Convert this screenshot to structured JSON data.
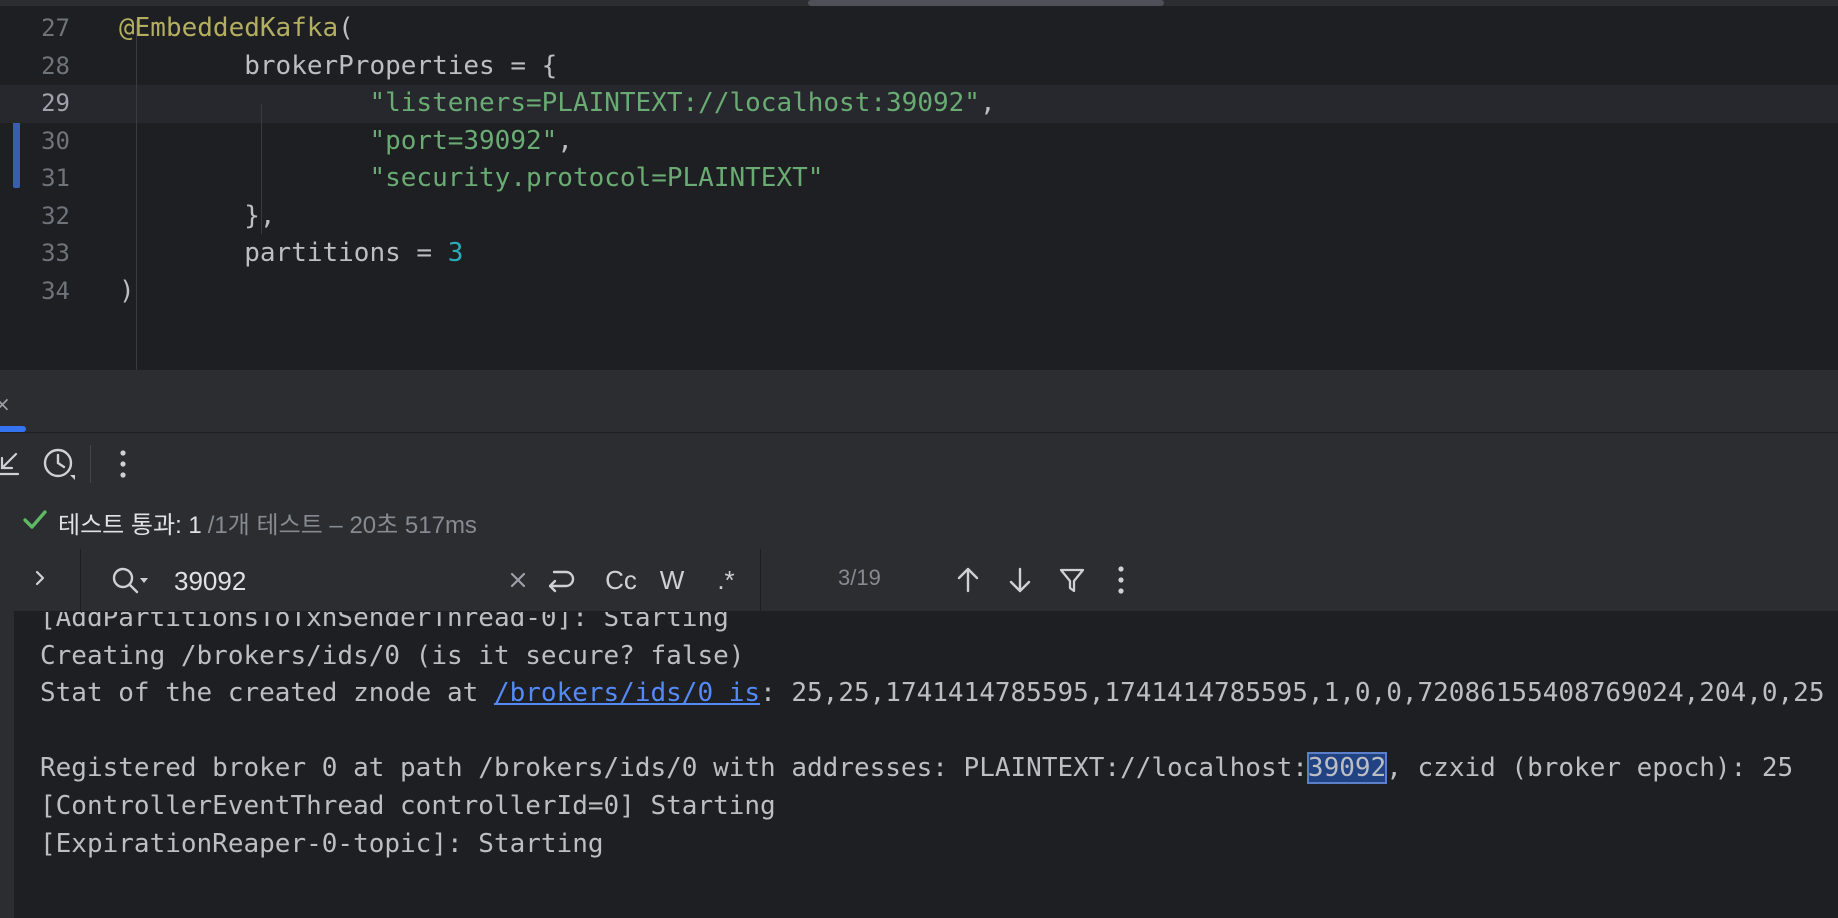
{
  "editor": {
    "lines": [
      {
        "num": "27",
        "indent": "",
        "parts": [
          {
            "t": "@EmbeddedKafka",
            "c": "ann"
          },
          {
            "t": "(",
            "c": ""
          }
        ]
      },
      {
        "num": "28",
        "indent": "        ",
        "parts": [
          {
            "t": "brokerProperties = {",
            "c": ""
          }
        ]
      },
      {
        "num": "29",
        "indent": "                ",
        "parts": [
          {
            "t": "\"listeners=PLAINTEXT://localhost:39092\"",
            "c": "str"
          },
          {
            "t": ",",
            "c": ""
          }
        ]
      },
      {
        "num": "30",
        "indent": "                ",
        "parts": [
          {
            "t": "\"port=39092\"",
            "c": "str"
          },
          {
            "t": ",",
            "c": ""
          }
        ]
      },
      {
        "num": "31",
        "indent": "                ",
        "parts": [
          {
            "t": "\"security.protocol=PLAINTEXT\"",
            "c": "str"
          }
        ]
      },
      {
        "num": "32",
        "indent": "        ",
        "parts": [
          {
            "t": "},",
            "c": ""
          }
        ]
      },
      {
        "num": "33",
        "indent": "        ",
        "parts": [
          {
            "t": "partitions = ",
            "c": ""
          },
          {
            "t": "3",
            "c": "num"
          }
        ]
      },
      {
        "num": "34",
        "indent": "",
        "parts": [
          {
            "t": ")",
            "c": ""
          }
        ]
      }
    ],
    "current_line": "29"
  },
  "panel": {
    "toolbar": {
      "icons": [
        "collapse-icon",
        "history-icon",
        "more-options-icon"
      ]
    },
    "test_status": {
      "main": "테스트 통과: 1",
      "sub": "/1개 테스트 – 20초 517ms"
    },
    "search": {
      "value": "39092",
      "placeholder": "",
      "case_label": "Cc",
      "words_label": "W",
      "regex_label": ".*",
      "match_count": "3/19"
    },
    "console_lines": [
      {
        "text": "[AddPartitionsToTxnSenderThread-0]: Starting"
      },
      {
        "text": "Creating /brokers/ids/0 (is it secure? false)"
      },
      {
        "before": "Stat of the created znode at ",
        "link": "/brokers/ids/0 is",
        "after": ": 25,25,1741414785595,1741414785595,1,0,0,72086155408769024,204,0,25"
      },
      {
        "text": ""
      },
      {
        "before": "Registered broker 0 at path /brokers/ids/0 with addresses: PLAINTEXT://localhost:",
        "highlight": "39092",
        "after": ", czxid (broker epoch): 25"
      },
      {
        "text": "[ControllerEventThread controllerId=0] Starting"
      },
      {
        "text": "[ExpirationReaper-0-topic]: Starting"
      }
    ]
  },
  "colors": {
    "annotation": "#b3ae60",
    "string": "#6aab73",
    "number": "#2aacb8",
    "link": "#548af7",
    "accent": "#3574f0",
    "success": "#5fb865"
  }
}
